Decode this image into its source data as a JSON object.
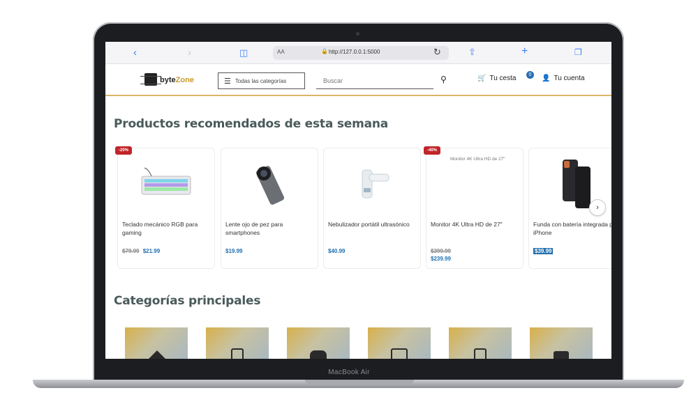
{
  "device": {
    "label": "MacBook Air"
  },
  "browser": {
    "reader_label": "AA",
    "url": "http://127.0.0.1:5000",
    "back_icon": "chevron-left-icon",
    "forward_icon": "chevron-right-icon",
    "book_icon": "book-icon",
    "reload_icon": "reload-icon",
    "share_icon": "share-icon",
    "new_tab_icon": "plus-icon",
    "tabs_icon": "tabs-icon"
  },
  "header": {
    "logo_text_dark": "byte",
    "logo_text_accent": "Zone",
    "categories_button": "Todas las categorías",
    "search_placeholder": "Buscar",
    "cart_label": "Tu cesta",
    "cart_count": "0",
    "account_label": "Tu cuenta"
  },
  "products_section": {
    "title": "Productos recomendados de esta semana",
    "products": [
      {
        "badge": "-20%",
        "name": "Teclado mecánico RGB para gaming",
        "old_price": "$79.99",
        "price": "$21.99",
        "image": "keyboard"
      },
      {
        "badge": "",
        "name": "Lente ojo de pez para smartphones",
        "old_price": "",
        "price": "$19.99",
        "image": "lens"
      },
      {
        "badge": "",
        "name": "Nebulizador portátil ultrasónico",
        "old_price": "",
        "price": "$40.99",
        "image": "nebulizer"
      },
      {
        "badge": "-40%",
        "name": "Monitor 4K Ultra HD de 27\"",
        "old_price": "$399.99",
        "price": "$239.99",
        "image_alt": "Monitor 4K Ultra HD de 27\""
      },
      {
        "badge": "",
        "name": "Funda con batería integrada para iPhone",
        "old_price": "",
        "price": "$39.99",
        "image": "phone-case"
      }
    ],
    "next_label": "›"
  },
  "categories_section": {
    "title": "Categorías principales",
    "tiles": [
      "home-icon",
      "tablet-icon",
      "gamepad-icon",
      "laptop-icon",
      "watch-icon",
      "camera-icon"
    ]
  }
}
